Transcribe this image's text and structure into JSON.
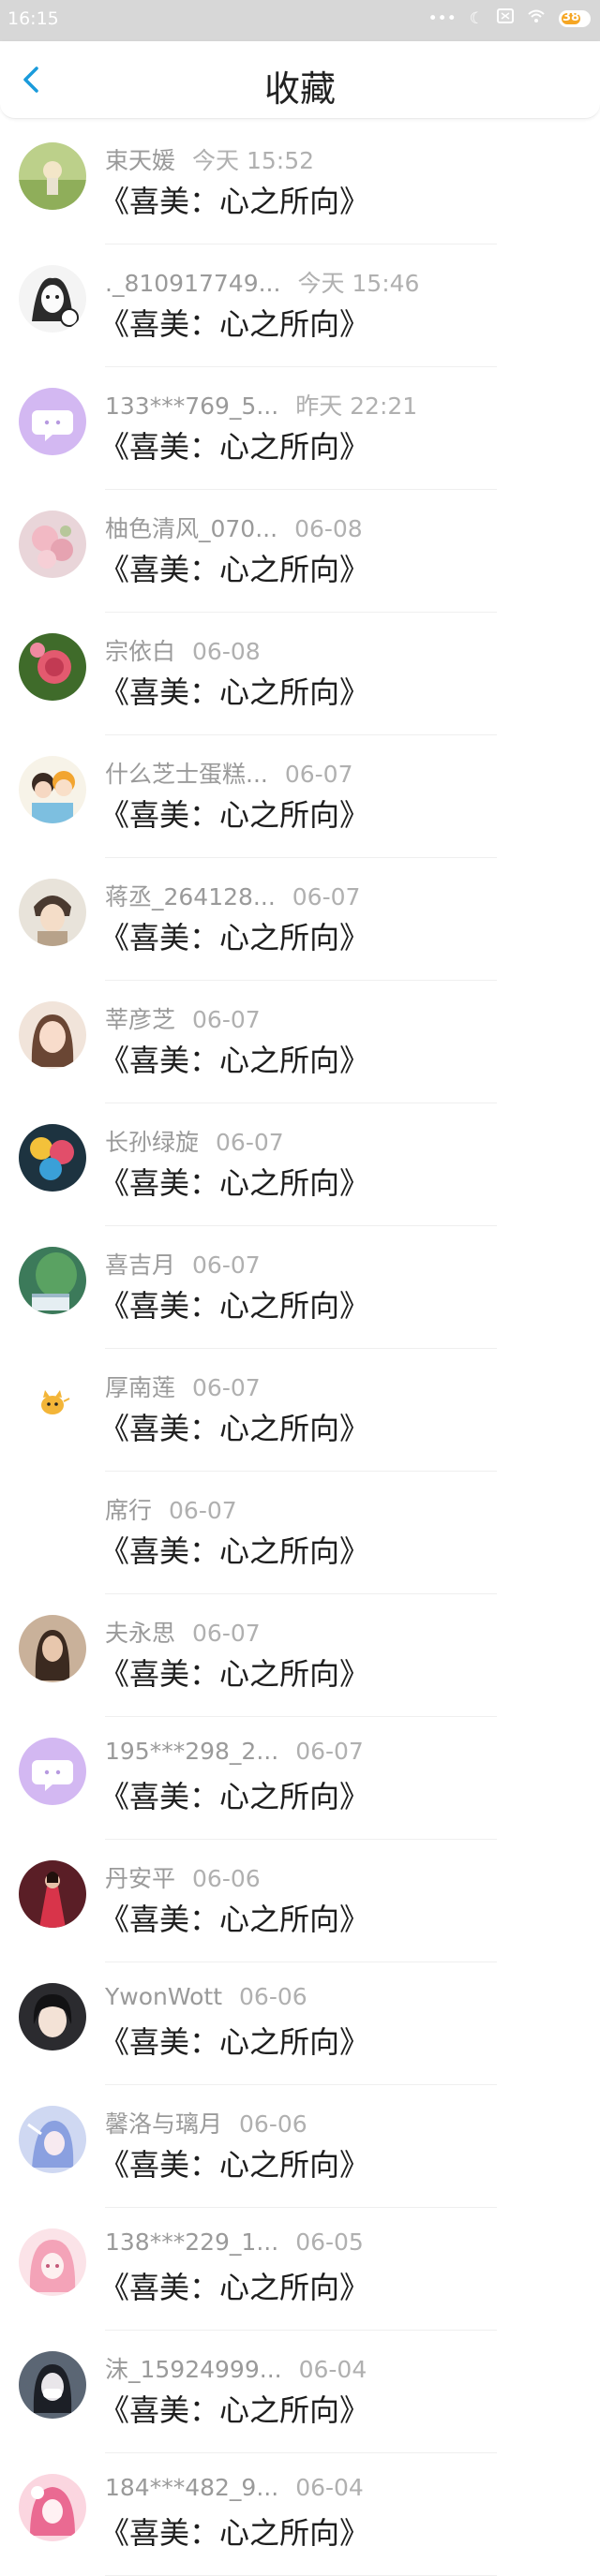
{
  "status_bar": {
    "time": "16:15",
    "battery": "38",
    "icons": [
      "more-dots-icon",
      "moon-icon",
      "screen-icon",
      "wifi-icon",
      "battery-icon"
    ]
  },
  "nav": {
    "title": "收藏",
    "back_icon": "chevron-left-icon",
    "accent": "#1a9bdb"
  },
  "items": [
    {
      "name": "束天媛",
      "time": "今天 15:52",
      "title": "《喜美：心之所向》",
      "avatar": "photo-green"
    },
    {
      "name": "._810917749...",
      "time": "今天 15:46",
      "title": "《喜美：心之所向》",
      "avatar": "sketch-girl"
    },
    {
      "name": "133***769_5...",
      "time": "昨天 22:21",
      "title": "《喜美：心之所向》",
      "avatar": "default-purple"
    },
    {
      "name": "柚色清风_070...",
      "time": "06-08",
      "title": "《喜美：心之所向》",
      "avatar": "flower-pink"
    },
    {
      "name": "宗依白",
      "time": "06-08",
      "title": "《喜美：心之所向》",
      "avatar": "rose-red"
    },
    {
      "name": "什么芝士蛋糕...",
      "time": "06-07",
      "title": "《喜美：心之所向》",
      "avatar": "anime-couple"
    },
    {
      "name": "蒋丞_264128...",
      "time": "06-07",
      "title": "《喜美：心之所向》",
      "avatar": "anime-boy"
    },
    {
      "name": "莘彦芝",
      "time": "06-07",
      "title": "《喜美：心之所向》",
      "avatar": "girl-light"
    },
    {
      "name": "长孙绿旋",
      "time": "06-07",
      "title": "《喜美：心之所向》",
      "avatar": "balloons"
    },
    {
      "name": "喜吉月",
      "time": "06-07",
      "title": "《喜美：心之所向》",
      "avatar": "cactus"
    },
    {
      "name": "厚南莲",
      "time": "06-07",
      "title": "《喜美：心之所向》",
      "avatar": "cat-sticker"
    },
    {
      "name": "席行",
      "time": "06-07",
      "title": "《喜美：心之所向》",
      "avatar": "blank"
    },
    {
      "name": "夫永思",
      "time": "06-07",
      "title": "《喜美：心之所向》",
      "avatar": "girl-brown"
    },
    {
      "name": "195***298_2...",
      "time": "06-07",
      "title": "《喜美：心之所向》",
      "avatar": "default-purple"
    },
    {
      "name": "丹安平",
      "time": "06-06",
      "title": "《喜美：心之所向》",
      "avatar": "red-dress"
    },
    {
      "name": "YwonWott",
      "time": "06-06",
      "title": "《喜美：心之所向》",
      "avatar": "girl-dark"
    },
    {
      "name": "馨洛与璃月",
      "time": "06-06",
      "title": "《喜美：心之所向》",
      "avatar": "anime-blue"
    },
    {
      "name": "138***229_1...",
      "time": "06-05",
      "title": "《喜美：心之所向》",
      "avatar": "anime-pink"
    },
    {
      "name": "沫_15924999...",
      "time": "06-04",
      "title": "《喜美：心之所向》",
      "avatar": "girl-mask"
    },
    {
      "name": "184***482_9...",
      "time": "06-04",
      "title": "《喜美：心之所向》",
      "avatar": "anime-pink2"
    }
  ]
}
